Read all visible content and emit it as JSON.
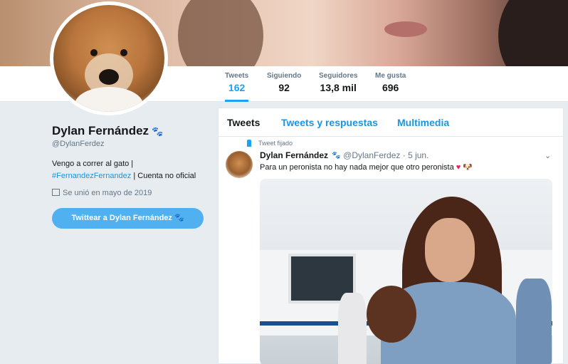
{
  "profile": {
    "name": "Dylan Fernández",
    "name_emoji": "🐾",
    "handle": "@DylanFerdez",
    "bio_line1": "Vengo a correr al gato |",
    "bio_hashtag": "#FernandezFernandez",
    "bio_line2_rest": " | Cuenta no oficial",
    "joined": "Se unió en mayo de 2019",
    "tweet_to_button": "Twittear a Dylan Fernández 🐾"
  },
  "stats": [
    {
      "label": "Tweets",
      "value": "162"
    },
    {
      "label": "Siguiendo",
      "value": "92"
    },
    {
      "label": "Seguidores",
      "value": "13,8 mil"
    },
    {
      "label": "Me gusta",
      "value": "696"
    }
  ],
  "tabs": [
    "Tweets",
    "Tweets y respuestas",
    "Multimedia"
  ],
  "tweet": {
    "pinned_label": "Tweet fijado",
    "author": "Dylan Fernández",
    "author_emoji": "🐾",
    "handle": "@DylanFerdez",
    "date": "5 jun.",
    "text": "Para un peronista no hay nada mejor que otro peronista",
    "text_emoji": "🐶"
  },
  "colors": {
    "accent": "#1da1f2",
    "link": "#1b95e0",
    "background": "#e6ecf0"
  }
}
